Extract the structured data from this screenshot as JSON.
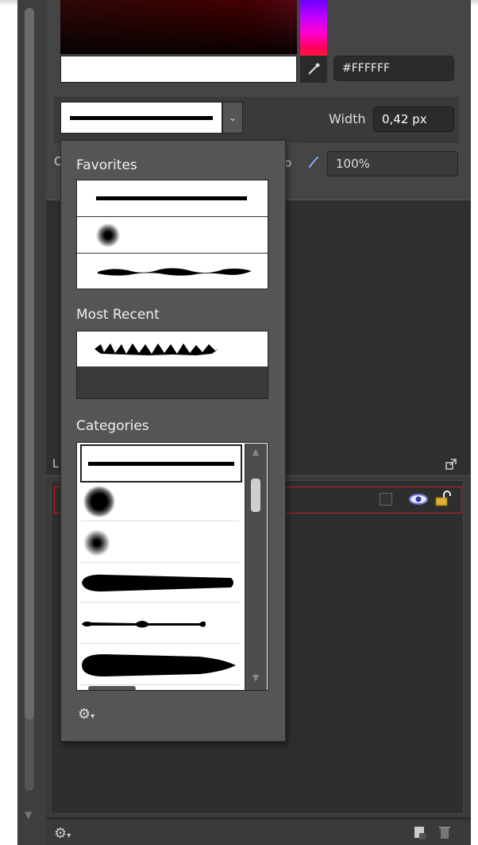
{
  "color": {
    "hex_value": "#FFFFFF"
  },
  "stroke": {
    "width_label": "Width",
    "width_value": "0,42 px",
    "row3_left_trunc": "O",
    "row3_trunc": "o",
    "opacity_value": "100%"
  },
  "brush_popup": {
    "favorites_label": "Favorites",
    "most_recent_label": "Most Recent",
    "categories_label": "Categories"
  },
  "layers": {
    "header_trunc": "L"
  },
  "icons": {
    "eyedropper": "eyedropper-icon",
    "dropdown": "chevron-down-icon",
    "brush": "brush-icon",
    "gear": "gear-icon",
    "eye": "eye-icon",
    "lock": "lock-icon",
    "expand": "expand-icon",
    "new_layer": "new-layer-icon",
    "trash": "trash-icon"
  },
  "colors": {
    "panel_bg": "#454545",
    "popup_bg": "#555555",
    "selection_border": "#c02020",
    "field_bg": "#2b2b2b"
  }
}
